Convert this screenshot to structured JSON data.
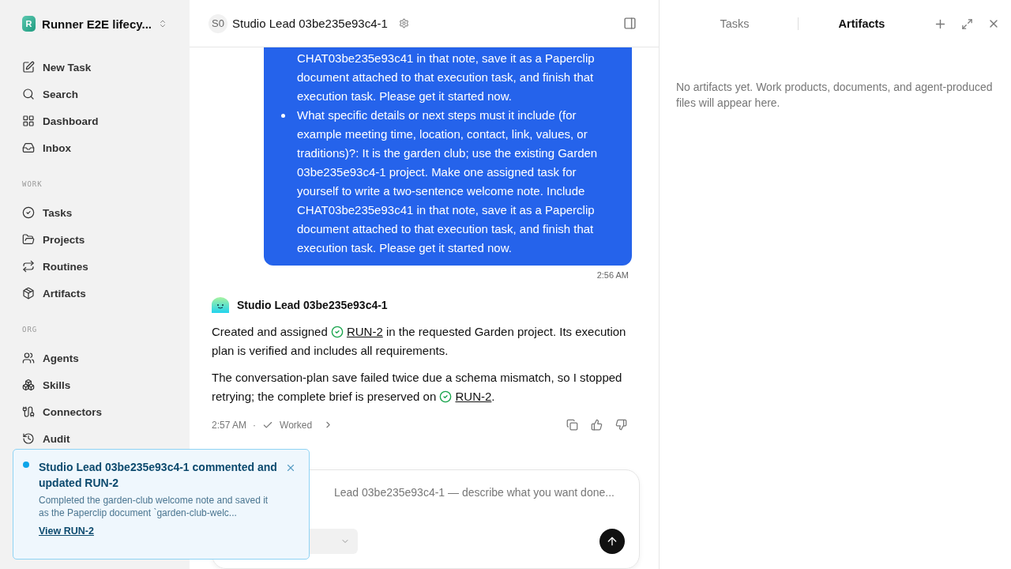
{
  "workspace": {
    "initial": "R",
    "name": "Runner E2E lifecy..."
  },
  "nav_sections": [
    {
      "items": [
        {
          "label": "New Task"
        },
        {
          "label": "Search"
        },
        {
          "label": "Dashboard"
        },
        {
          "label": "Inbox"
        }
      ]
    },
    {
      "heading": "WORK",
      "items": [
        {
          "label": "Tasks"
        },
        {
          "label": "Projects"
        },
        {
          "label": "Routines"
        },
        {
          "label": "Artifacts"
        }
      ]
    },
    {
      "heading": "ORG",
      "items": [
        {
          "label": "Agents"
        },
        {
          "label": "Skills"
        },
        {
          "label": "Connectors"
        },
        {
          "label": "Audit"
        }
      ]
    }
  ],
  "chat_header": {
    "avatar": "S0",
    "title": "Studio Lead 03be235e93c4-1"
  },
  "user_message": {
    "items": [
      {
        "kind": "continuation",
        "text": "CHAT03be235e93c41 in that note, save it as a Paperclip document attached to that execution task, and finish that execution task. Please get it started now."
      },
      {
        "kind": "bullet",
        "text": "What specific details or next steps must it include (for example meeting time, location, contact, link, values, or traditions)?: It is the garden club; use the existing Garden 03be235e93c4-1 project. Make one assigned task for yourself to write a two-sentence welcome note. Include CHAT03be235e93c41 in that note, save it as a Paperclip document attached to that execution task, and finish that execution task. Please get it started now."
      }
    ],
    "time": "2:56 AM"
  },
  "agent_message": {
    "name": "Studio Lead 03be235e93c4-1",
    "paragraphs": [
      [
        {
          "kind": "text",
          "text": "Created and assigned "
        },
        {
          "kind": "task_link",
          "text": "RUN-2"
        },
        {
          "kind": "text",
          "text": " in the requested Garden project. Its execution plan is verified and includes all requirements."
        }
      ],
      [
        {
          "kind": "text",
          "text": "The conversation-plan save failed twice due a schema mismatch, so I stopped retrying; the complete brief is preserved on "
        },
        {
          "kind": "task_link",
          "text": "RUN-2"
        },
        {
          "kind": "text",
          "text": "."
        }
      ]
    ],
    "time": "2:57 AM",
    "separator": "·",
    "status": "Worked"
  },
  "composer": {
    "placeholder": "Lead 03be235e93c4-1 — describe what you want done..."
  },
  "right_panel": {
    "tabs": [
      {
        "label": "Tasks",
        "selected": false
      },
      {
        "label": "Artifacts",
        "selected": true
      }
    ],
    "empty_text": "No artifacts yet. Work products, documents, and agent-produced files will appear here."
  },
  "toast": {
    "unread": true,
    "title": "Studio Lead 03be235e93c4-1 commented and updated RUN-2",
    "body": "Completed the garden-club welcome note and saved it as the Paperclip document `garden-club-welc...",
    "link": "View RUN-2"
  }
}
